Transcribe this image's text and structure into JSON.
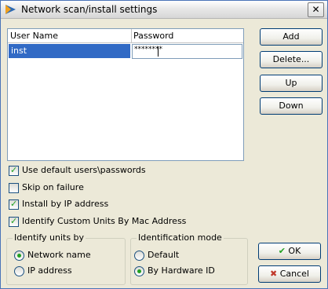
{
  "window": {
    "title": "Network scan/install settings",
    "close_glyph": "✕"
  },
  "grid": {
    "columns": [
      "User Name",
      "Password"
    ],
    "rows": [
      {
        "user": "inst",
        "password": "********"
      }
    ]
  },
  "buttons": {
    "add": "Add",
    "delete": "Delete...",
    "up": "Up",
    "down": "Down",
    "ok": "OK",
    "cancel": "Cancel"
  },
  "options": {
    "use_default": {
      "label": "Use default users\\passwords",
      "checked": true
    },
    "skip_on_failure": {
      "label": "Skip on failure",
      "checked": false
    },
    "install_by_ip": {
      "label": "Install by IP address",
      "checked": true
    },
    "identify_custom": {
      "label": "Identify Custom Units By Mac Address",
      "checked": true
    }
  },
  "identify_units_by": {
    "title": "Identify units by",
    "options": [
      {
        "label": "Network name",
        "selected": true
      },
      {
        "label": "IP address",
        "selected": false
      }
    ]
  },
  "identification_mode": {
    "title": "Identification mode",
    "options": [
      {
        "label": "Default",
        "selected": false
      },
      {
        "label": "By Hardware ID",
        "selected": true
      }
    ]
  },
  "colors": {
    "selection": "#316ac5",
    "check": "#21a121",
    "cancel_x": "#c0392b"
  }
}
